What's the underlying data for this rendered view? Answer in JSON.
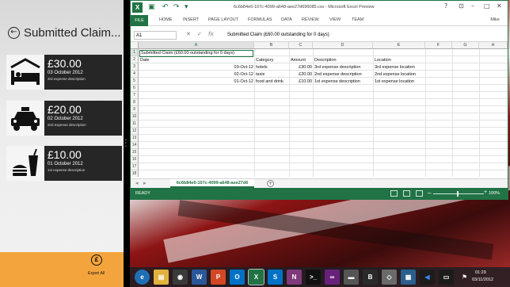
{
  "app": {
    "title": "Submitted Claim...",
    "claims": [
      {
        "amount": "£30.00",
        "date": "03 October 2012",
        "description": "3rd expense description",
        "icon": "hotel-bed-icon"
      },
      {
        "amount": "£20.00",
        "date": "02 October 2012",
        "description": "2nd expense description",
        "icon": "taxi-icon"
      },
      {
        "amount": "£10.00",
        "date": "01 October 2012",
        "description": "1st expense description",
        "icon": "food-drink-icon"
      }
    ],
    "export_label": "Export All",
    "export_icon_glyph": "₤",
    "accent_color": "#f4a43d"
  },
  "excel": {
    "window_title": "6c6b84e6-107c-4099-a648-aee27d696085.csv - Microsoft Excel Preview",
    "ribbon_tabs": [
      "HOME",
      "INSERT",
      "PAGE LAYOUT",
      "FORMULAS",
      "DATA",
      "REVIEW",
      "VIEW",
      "TEAM"
    ],
    "file_tab": "FILE",
    "user": "Mike",
    "name_box": "A1",
    "formula": "Submitted Claim (£60.00 outstanding for 0 days)",
    "columns": [
      "A",
      "B",
      "C",
      "D",
      "E",
      "F",
      "G",
      "H"
    ],
    "rows": [
      "1",
      "2",
      "3",
      "4",
      "5",
      "6",
      "7",
      "8",
      "9",
      "10",
      "11",
      "12",
      "13",
      "14",
      "15",
      "16",
      "17",
      "18"
    ],
    "cells": {
      "a1": "Submitted Claim (£60.00 outstanding for 0 days)",
      "a2": "Date",
      "b2": "Category",
      "c2": "Amount",
      "d2": "Description",
      "e2": "Location",
      "a3": "03-Oct-12",
      "b3": "hotels",
      "c3": "£30.00",
      "d3": "3rd expense description",
      "e3": "3rd expense location",
      "a4": "02-Oct-12",
      "b4": "taxis",
      "c4": "£20.00",
      "d4": "2nd expense description",
      "e4": "2nd expense location",
      "a5": "01-Oct-12",
      "b5": "food and drink",
      "c5": "£10.00",
      "d5": "1st expense description",
      "e5": "1st expense location"
    },
    "sheet_tab": "6c6b84e6-107c-4099-a648-aee27d6",
    "status": "READY",
    "zoom": "100%",
    "brand_color": "#217346"
  },
  "taskbar": {
    "time": "01:29",
    "date": "03/11/2012"
  }
}
